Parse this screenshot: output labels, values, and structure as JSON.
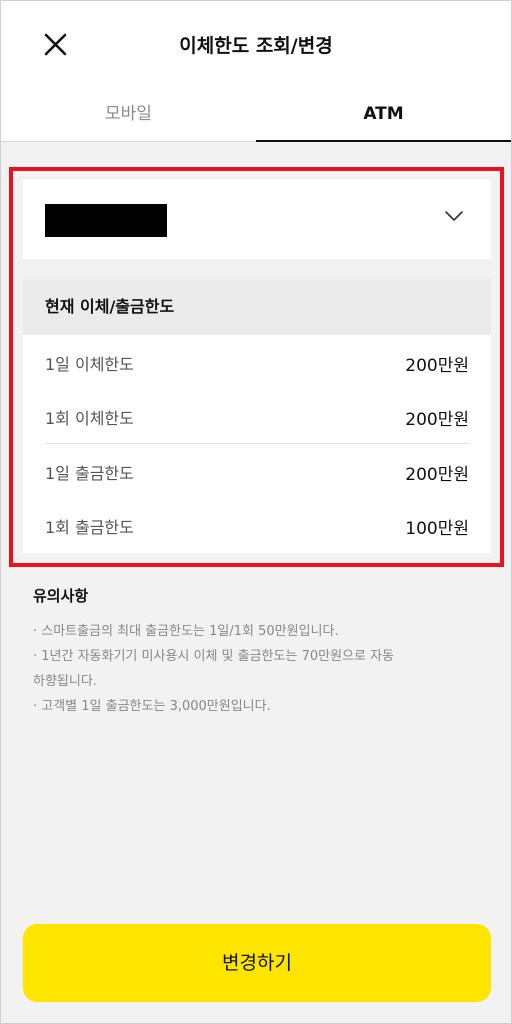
{
  "header": {
    "title": "이체한도 조회/변경",
    "close_icon": "close-icon"
  },
  "tabs": [
    {
      "label": "모바일",
      "active": false
    },
    {
      "label": "ATM",
      "active": true
    }
  ],
  "account": {
    "redacted": true,
    "chevron_icon": "chevron-down-icon"
  },
  "limits": {
    "title": "현재 이체/출금한도",
    "rows": [
      {
        "label": "1일 이체한도",
        "value": "200만원"
      },
      {
        "label": "1회 이체한도",
        "value": "200만원"
      },
      {
        "label": "1일 출금한도",
        "value": "200만원"
      },
      {
        "label": "1회 출금한도",
        "value": "100만원"
      }
    ]
  },
  "notice": {
    "title": "유의사항",
    "items": [
      "· 스마트출금의 최대 출금한도는 1일/1회 50만원입니다.",
      "· 1년간 자동화기기 미사용시 이체 및 출금한도는 70만원으로 자동",
      "하향됩니다.",
      "· 고객별 1일 출금한도는 3,000만원입니다."
    ]
  },
  "action": {
    "label": "변경하기"
  },
  "colors": {
    "accent": "#fee500",
    "highlight": "#e8141b",
    "background": "#f2f2f2"
  }
}
